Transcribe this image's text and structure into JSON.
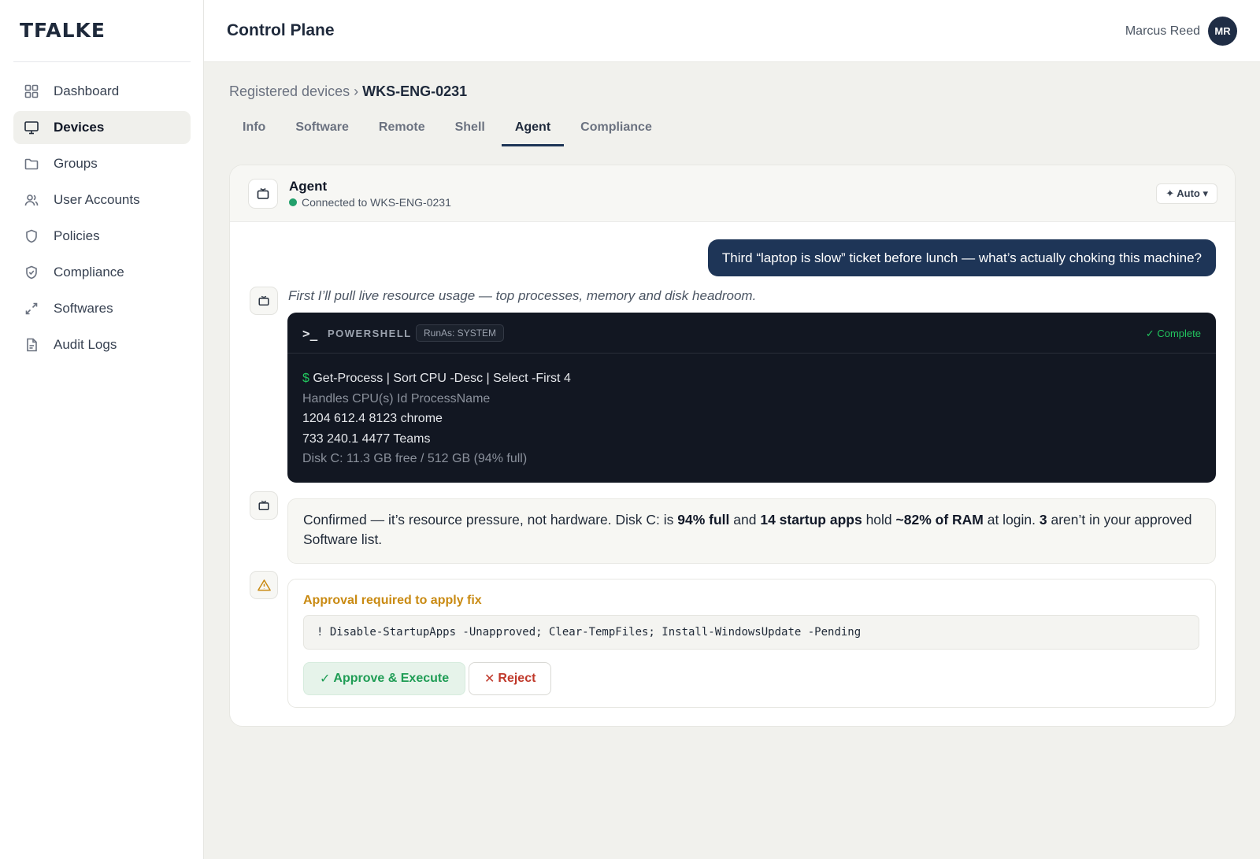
{
  "brand": {
    "logo": "TFALKE"
  },
  "sidebar": {
    "items": [
      {
        "label": "Dashboard",
        "icon": "grid-icon"
      },
      {
        "label": "Devices",
        "icon": "monitor-icon",
        "active": true
      },
      {
        "label": "Groups",
        "icon": "folder-icon"
      },
      {
        "label": "User Accounts",
        "icon": "users-icon"
      },
      {
        "label": "Policies",
        "icon": "shield-icon"
      },
      {
        "label": "Compliance",
        "icon": "shield-check-icon"
      },
      {
        "label": "Softwares",
        "icon": "expand-arrows-icon"
      },
      {
        "label": "Audit Logs",
        "icon": "document-icon"
      }
    ]
  },
  "header": {
    "title": "Control Plane",
    "user_name": "Marcus Reed",
    "avatar_initials": "MR"
  },
  "breadcrumb": {
    "parent": "Registered devices",
    "separator": "›",
    "current": "WKS-ENG-0231"
  },
  "tabs": [
    {
      "label": "Info"
    },
    {
      "label": "Software"
    },
    {
      "label": "Remote"
    },
    {
      "label": "Shell"
    },
    {
      "label": "Agent",
      "active": true
    },
    {
      "label": "Compliance"
    }
  ],
  "agent": {
    "title": "Agent",
    "status": "Connected to WKS-ENG-0231",
    "status_color": "#22a06b",
    "mode_button": "✦ Auto ▾"
  },
  "chat": {
    "user_message": "Third “laptop is slow” ticket before lunch — what’s actually choking this machine?",
    "thinking": "First I’ll pull live resource usage — top processes, memory and disk headroom.",
    "terminal": {
      "prompt_glyph": ">_",
      "label": "POWERSHELL",
      "runas": "RunAs: SYSTEM",
      "status": "✓ Complete",
      "dollar": "$",
      "command": " Get-Process | Sort CPU -Desc | Select -First 4",
      "output": [
        "Handles CPU(s) Id ProcessName",
        "1204 612.4 8123 chrome",
        "733 240.1 4477 Teams",
        "Disk C: 11.3 GB free / 512 GB (94% full)"
      ]
    },
    "response": {
      "t1": "Confirmed — it’s resource pressure, not hardware. Disk C: is ",
      "b1": "94% full",
      "t2": " and ",
      "b2": "14 startup apps",
      "t3": " hold ",
      "b3": "~82% of RAM",
      "t4": " at login. ",
      "b4": "3",
      "t5": " aren’t in your approved Software list."
    },
    "approval": {
      "title": "Approval required to apply fix",
      "title_color": "#c98a12",
      "command": "! Disable-StartupApps -Unapproved; Clear-TempFiles; Install-WindowsUpdate -Pending",
      "approve_glyph": "✓",
      "approve_label": "Approve & Execute",
      "reject_glyph": "✕",
      "reject_label": "Reject"
    }
  }
}
